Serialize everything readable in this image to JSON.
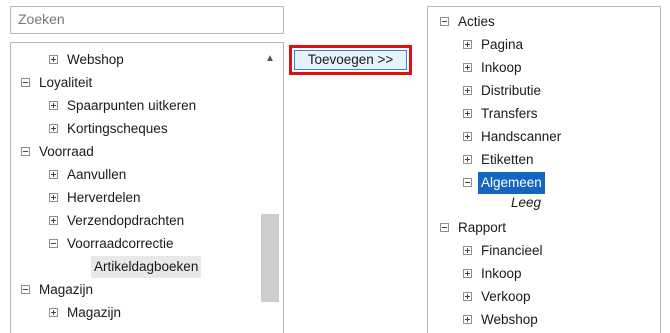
{
  "search": {
    "placeholder": "Zoeken"
  },
  "add_button": {
    "label": "Toevoegen >>"
  },
  "left_tree": [
    {
      "label": "Webshop",
      "expander": "plus"
    },
    {
      "label": "Loyaliteit",
      "expander": "minus"
    },
    {
      "label": "Spaarpunten uitkeren",
      "expander": "plus"
    },
    {
      "label": "Kortingscheques",
      "expander": "plus"
    },
    {
      "label": "Voorraad",
      "expander": "minus"
    },
    {
      "label": "Aanvullen",
      "expander": "plus"
    },
    {
      "label": "Herverdelen",
      "expander": "plus"
    },
    {
      "label": "Verzendopdrachten",
      "expander": "plus"
    },
    {
      "label": "Voorraadcorrectie",
      "expander": "minus"
    },
    {
      "label": "Artikeldagboeken",
      "expander": "none",
      "state": "hover"
    },
    {
      "label": "Magazijn",
      "expander": "minus"
    },
    {
      "label": "Magazijn",
      "expander": "plus"
    }
  ],
  "right_tree": [
    {
      "label": "Acties",
      "expander": "minus"
    },
    {
      "label": "Pagina",
      "expander": "plus"
    },
    {
      "label": "Inkoop",
      "expander": "plus"
    },
    {
      "label": "Distributie",
      "expander": "plus"
    },
    {
      "label": "Transfers",
      "expander": "plus"
    },
    {
      "label": "Handscanner",
      "expander": "plus"
    },
    {
      "label": "Etiketten",
      "expander": "plus"
    },
    {
      "label": "Algemeen",
      "expander": "minus",
      "state": "selected"
    },
    {
      "label": "Leeg",
      "expander": "none",
      "style": "italic"
    },
    {
      "label": "Rapport",
      "expander": "minus"
    },
    {
      "label": "Financieel",
      "expander": "plus"
    },
    {
      "label": "Inkoop",
      "expander": "plus"
    },
    {
      "label": "Verkoop",
      "expander": "plus"
    },
    {
      "label": "Webshop",
      "expander": "plus"
    }
  ],
  "icons": {
    "expand": "plus-box-icon",
    "collapse": "minus-box-icon",
    "scroll_up": "chevron-up-icon"
  },
  "colors": {
    "highlight": "#e01010",
    "selection": "#1565c0",
    "button_bg": "#e5f1fb"
  }
}
